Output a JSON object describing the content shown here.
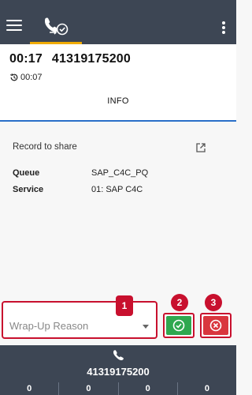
{
  "colors": {
    "topbar": "#3d4654",
    "tab_indicator": "#f0ab00",
    "accent_line": "#2a6fc9",
    "highlight": "#c8102e",
    "accept": "#2fa84f",
    "reject": "#d9363e"
  },
  "topbar": {
    "menu_icon": "hamburger-icon",
    "active_tab_icon": "call-completed-icon",
    "more_icon": "more-vertical-icon"
  },
  "call": {
    "duration": "00:17",
    "number": "41319175200",
    "hold_time": "00:07",
    "hold_icon": "history-icon"
  },
  "tabs": {
    "info_label": "INFO"
  },
  "info": {
    "record_label": "Record to share",
    "share_icon": "open-external-icon",
    "rows": [
      {
        "key": "Queue",
        "value": "SAP_C4C_PQ"
      },
      {
        "key": "Service",
        "value": "01: SAP C4C"
      }
    ]
  },
  "wrapup": {
    "placeholder": "Wrap-Up Reason",
    "badges": [
      "1",
      "2",
      "3"
    ],
    "accept_icon": "check-circle-icon",
    "reject_icon": "close-circle-icon"
  },
  "bottombar": {
    "phone_icon": "phone-icon",
    "number": "41319175200",
    "counters": [
      "0",
      "0",
      "0",
      "0"
    ]
  }
}
